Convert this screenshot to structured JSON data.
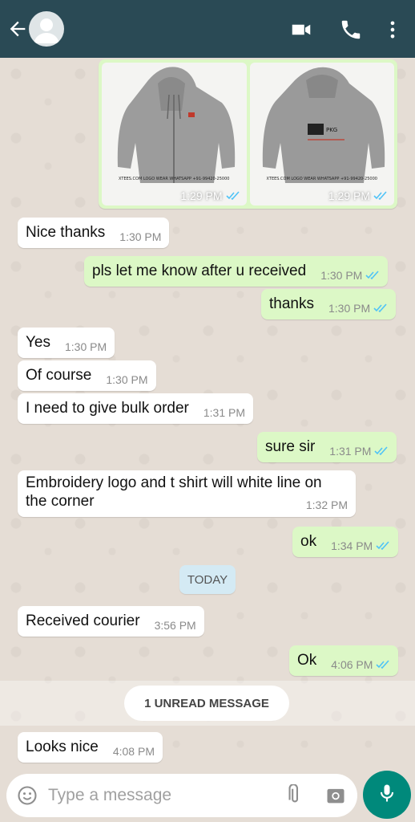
{
  "header": {
    "icons": [
      "back-arrow-icon",
      "avatar-icon",
      "video-call-icon",
      "phone-icon",
      "more-vert-icon"
    ],
    "colors": {
      "bar": "#2a4a55"
    }
  },
  "images": [
    {
      "time": "1:29 PM",
      "caption": "XTEES.COM  LOGO WEAR  WHATSAPP +91-99420-25000"
    },
    {
      "time": "1:29 PM",
      "caption": "XTEES.COM  LOGO WEAR  WHATSAPP +91-99420-25000"
    }
  ],
  "messages": [
    {
      "dir": "in",
      "text": "Nice thanks",
      "time": "1:30 PM"
    },
    {
      "dir": "out",
      "text": "pls let me know after u received",
      "time": "1:30 PM"
    },
    {
      "dir": "out",
      "text": "thanks",
      "time": "1:30 PM"
    },
    {
      "dir": "in",
      "text": "Yes",
      "time": "1:30 PM"
    },
    {
      "dir": "in",
      "text": "Of course",
      "time": "1:30 PM"
    },
    {
      "dir": "in",
      "text": "I need to give bulk order",
      "time": "1:31 PM"
    },
    {
      "dir": "out",
      "text": "sure sir",
      "time": "1:31 PM"
    },
    {
      "dir": "in",
      "text_line1": "Embroidery logo and t shirt will white line on",
      "text_line2": "the corner",
      "time": "1:32 PM"
    },
    {
      "dir": "out",
      "text": "ok",
      "time": "1:34 PM"
    },
    {
      "dir": "in",
      "text": "Received courier",
      "time": "3:56 PM"
    },
    {
      "dir": "out",
      "text": "Ok",
      "time": "4:06 PM"
    },
    {
      "dir": "in",
      "text": "Looks nice",
      "time": "4:08 PM"
    }
  ],
  "day_divider": "TODAY",
  "unread_divider": "1 UNREAD MESSAGE",
  "composer": {
    "placeholder": "Type a message",
    "icons": [
      "emoji-icon",
      "attach-icon",
      "camera-icon",
      "mic-icon"
    ]
  },
  "colors": {
    "incoming": "#ffffff",
    "outgoing": "#dcf8c6",
    "read_ticks": "#4fc3f7",
    "mic_button": "#00897b"
  }
}
